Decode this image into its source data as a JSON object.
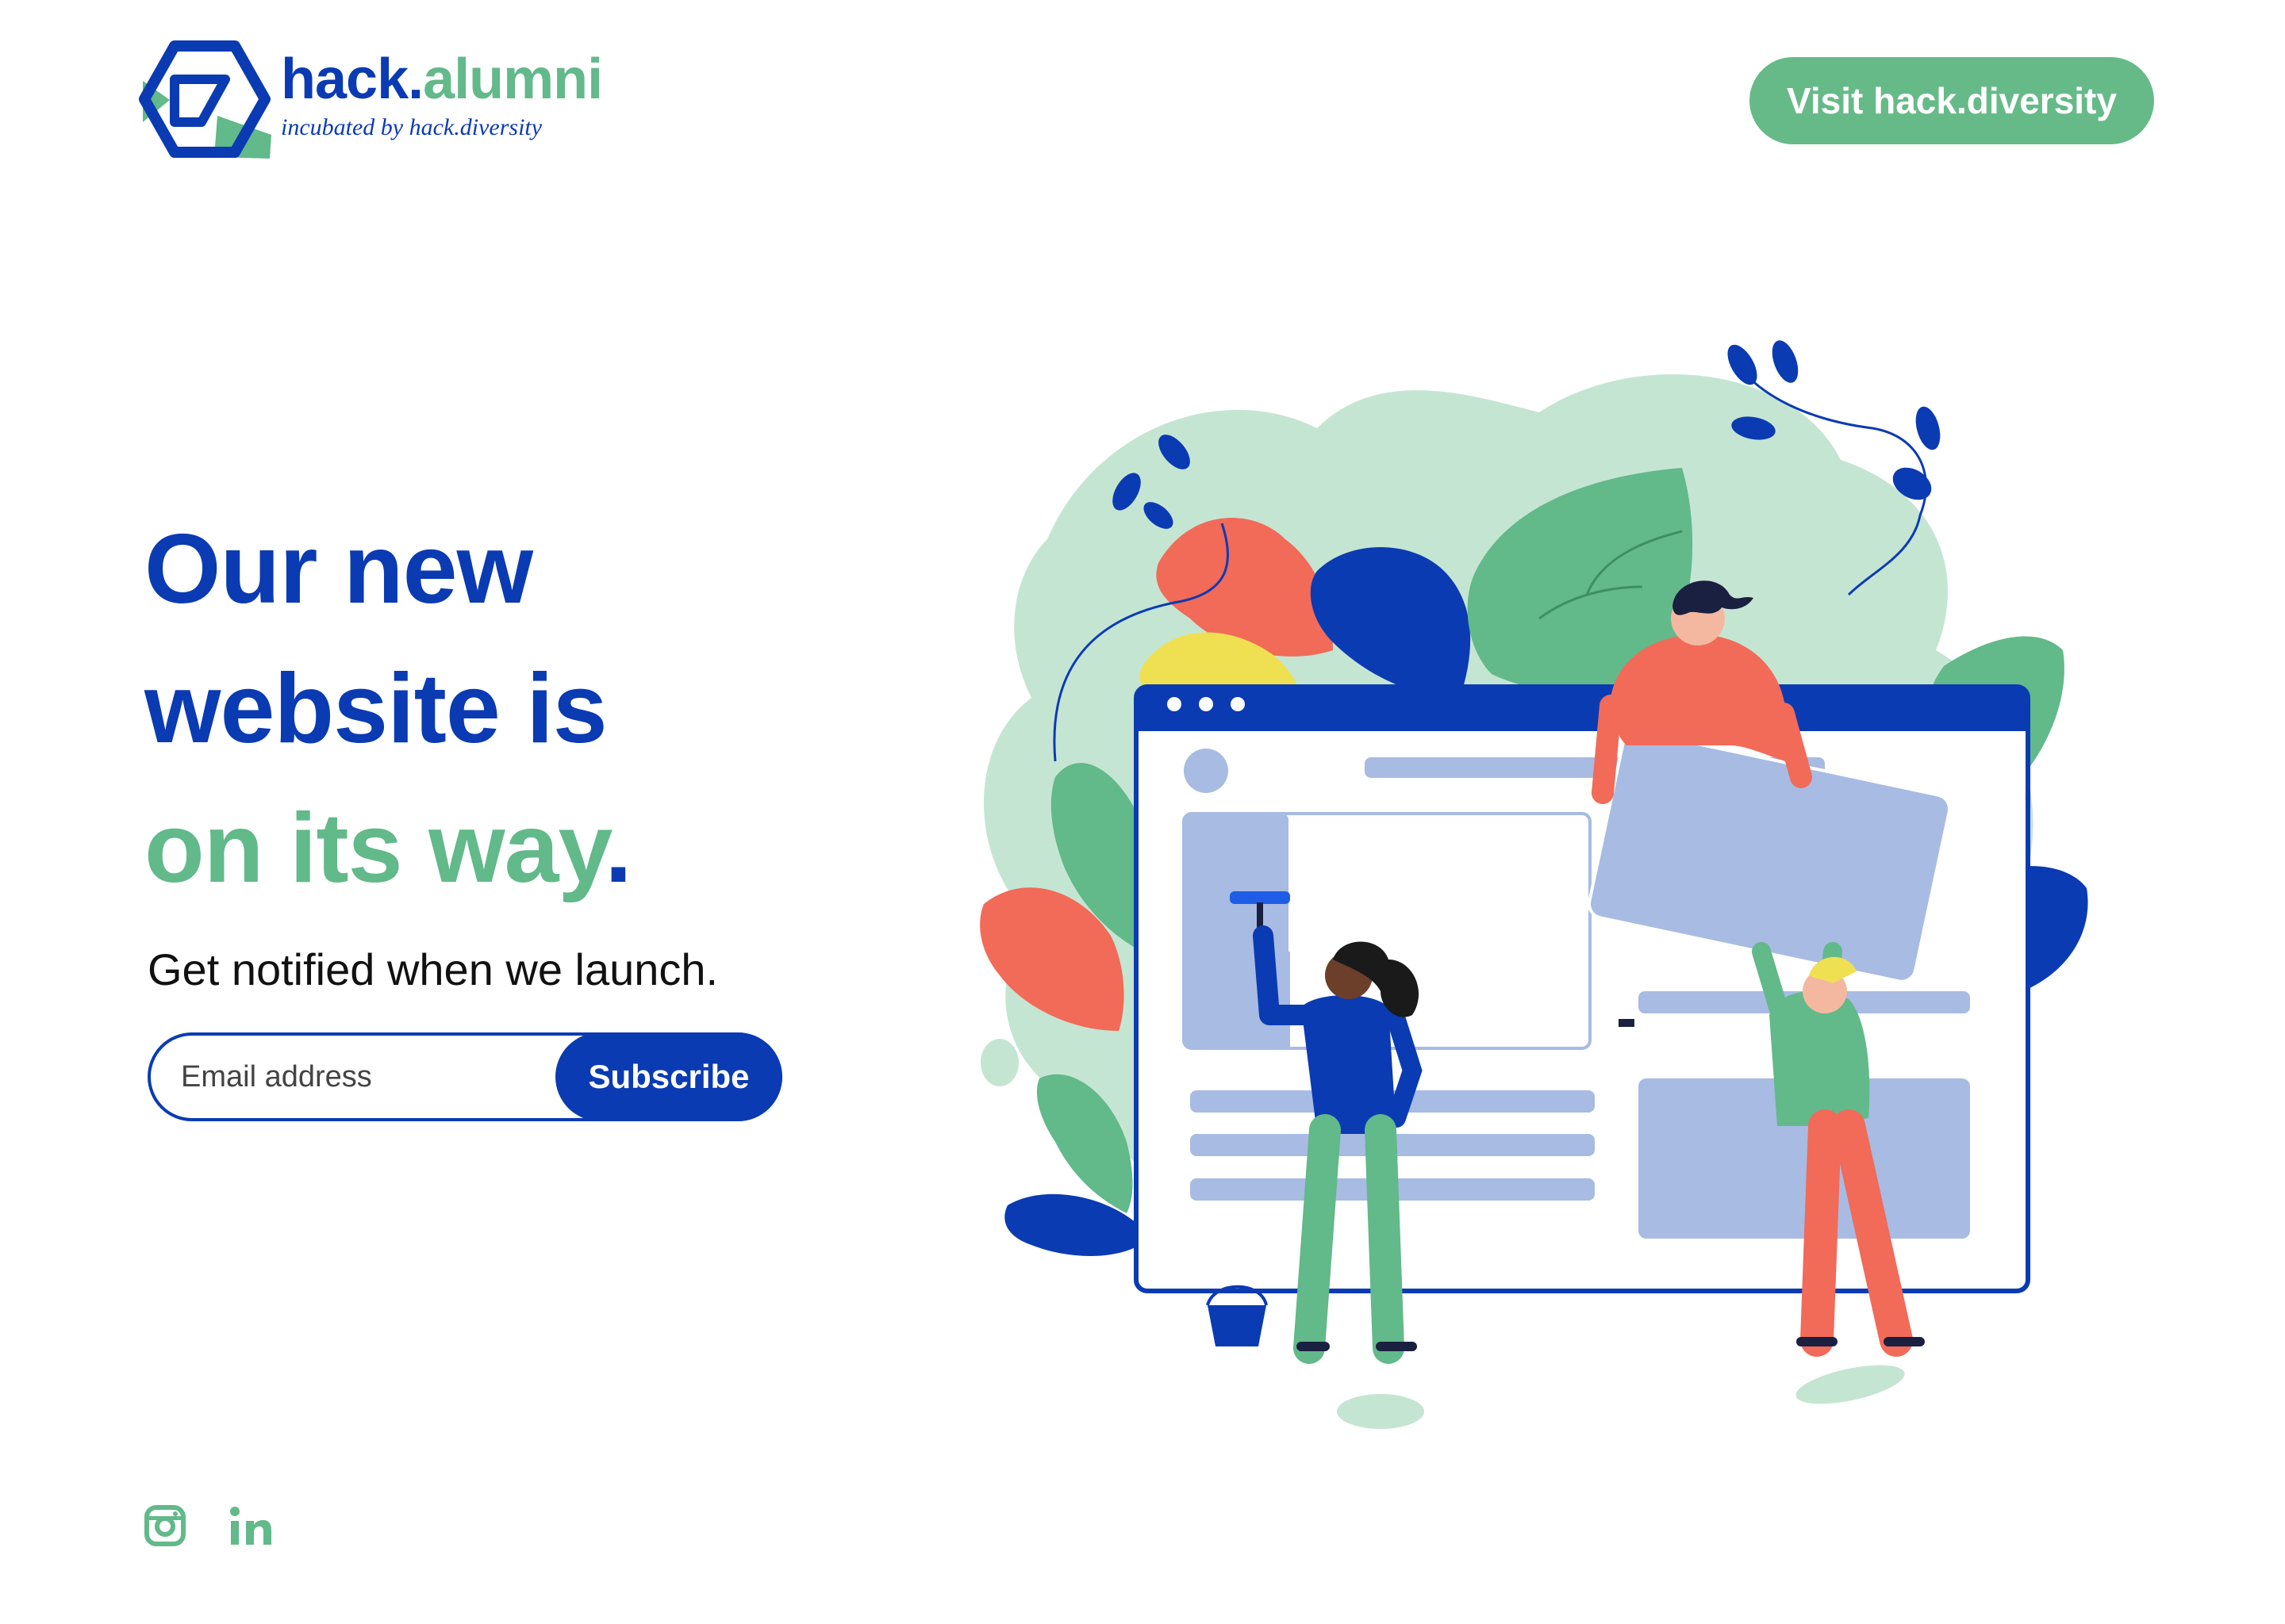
{
  "brand": {
    "name_part1": "hack",
    "name_dot": ".",
    "name_part2": "alumni",
    "tagline": "incubated by hack.diversity",
    "primary_color": "#0b3bb3",
    "accent_color": "#66ba88"
  },
  "header": {
    "visit_button_label": "Visit hack.diversity"
  },
  "hero": {
    "headline_line1": "Our new",
    "headline_line2": "website is",
    "headline_line3": "on its way",
    "headline_period": ".",
    "subheading": "Get notified when we launch."
  },
  "signup": {
    "email_placeholder": "Email address",
    "subscribe_label": "Subscribe"
  },
  "social": {
    "icons": [
      "instagram-icon",
      "linkedin-icon"
    ]
  }
}
